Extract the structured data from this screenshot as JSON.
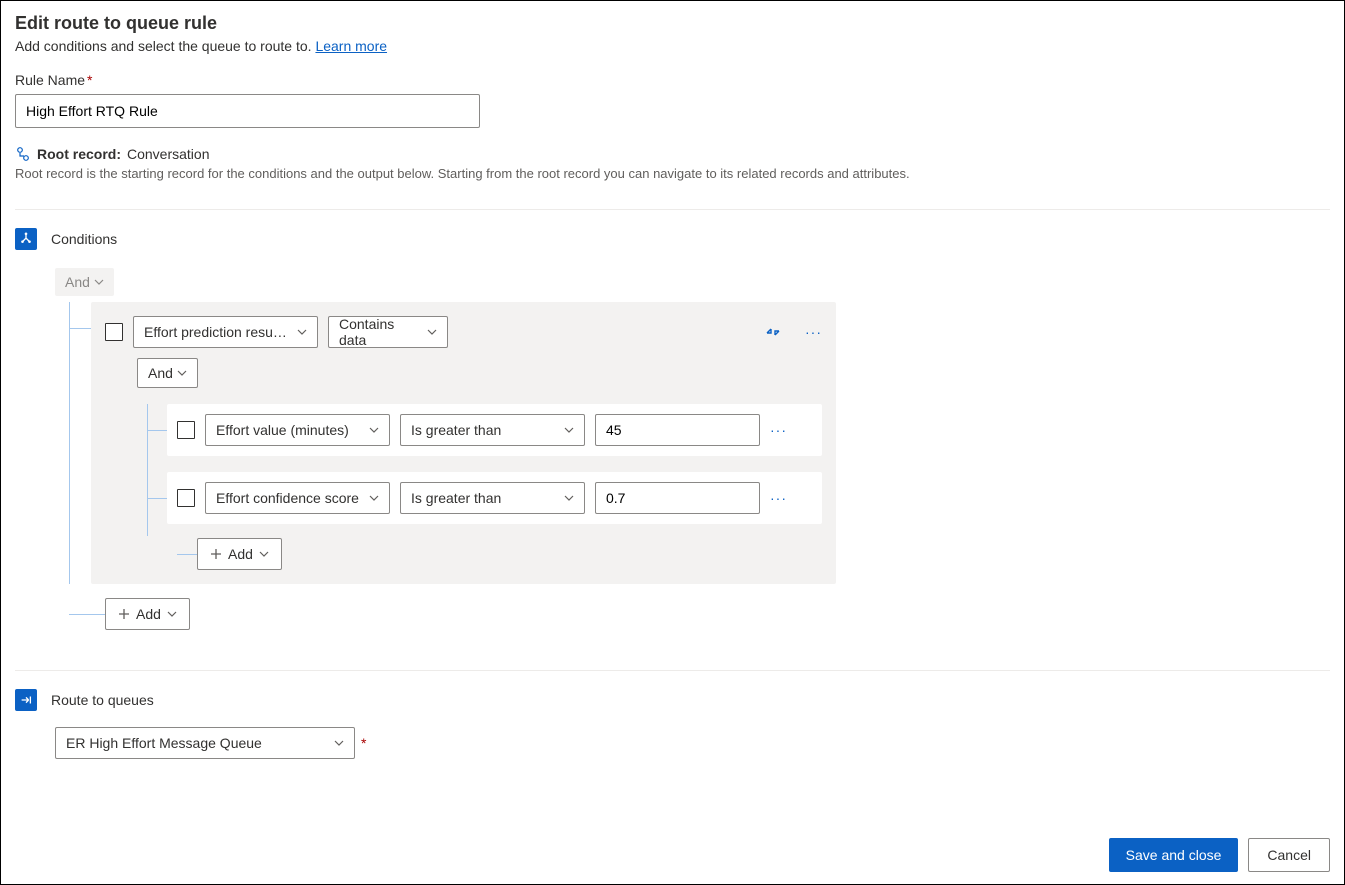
{
  "header": {
    "title": "Edit route to queue rule",
    "subtitle_static": "Add conditions and select the queue to route to. ",
    "learn_more": "Learn more"
  },
  "rule_name": {
    "label": "Rule Name",
    "value": "High Effort RTQ Rule"
  },
  "root_record": {
    "label": "Root record:",
    "value": "Conversation",
    "description": "Root record is the starting record for the conditions and the output below. Starting from the root record you can navigate to its related records and attributes."
  },
  "conditions": {
    "section_label": "Conditions",
    "outer_operator": "And",
    "group": {
      "attribute": "Effort prediction result...",
      "operator": "Contains data",
      "inner_operator": "And",
      "rows": [
        {
          "attribute": "Effort value (minutes)",
          "operator": "Is greater than",
          "value": "45"
        },
        {
          "attribute": "Effort confidence score",
          "operator": "Is greater than",
          "value": "0.7"
        }
      ],
      "add_label": "Add"
    },
    "outer_add_label": "Add"
  },
  "route": {
    "section_label": "Route to queues",
    "selected_queue": "ER High Effort Message Queue"
  },
  "footer": {
    "save": "Save and close",
    "cancel": "Cancel"
  }
}
